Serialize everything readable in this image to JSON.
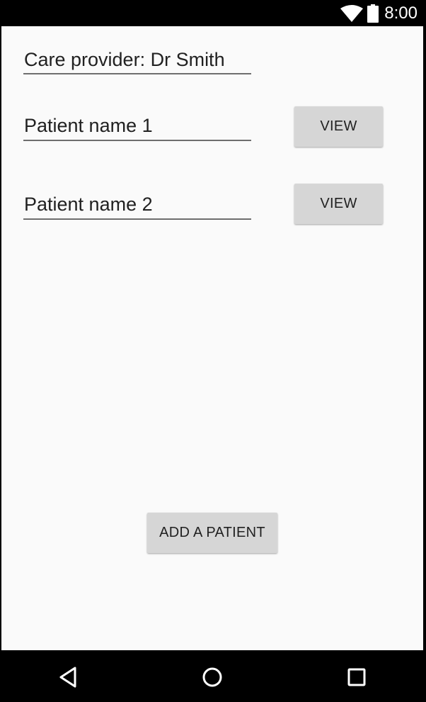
{
  "status_bar": {
    "time": "8:00",
    "icons": [
      "wifi-icon",
      "battery-icon"
    ]
  },
  "form": {
    "care_provider": "Care provider: Dr Smith",
    "patients": [
      {
        "name": "Patient name 1",
        "view_label": "VIEW"
      },
      {
        "name": "Patient name 2",
        "view_label": "VIEW"
      }
    ],
    "add_label": "ADD A PATIENT"
  },
  "nav_bar": {
    "icons": [
      "back-icon",
      "home-icon",
      "recents-icon"
    ]
  },
  "colors": {
    "background": "#fafafa",
    "button": "#d6d6d6",
    "text": "#212121",
    "underline": "#6e6e6e",
    "bars": "#000000"
  }
}
